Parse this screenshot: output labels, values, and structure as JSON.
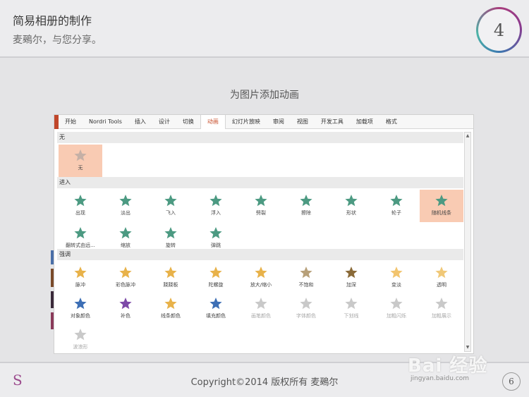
{
  "header": {
    "title": "简易相册的制作",
    "subtitle": "麦鵐尔，与您分享。",
    "chapter_number": "4"
  },
  "caption": "为图片添加动画",
  "ribbon": {
    "tabs": [
      "开始",
      "Nordri Tools",
      "插入",
      "设计",
      "切换",
      "动画",
      "幻灯片放映",
      "审阅",
      "视图",
      "开发工具",
      "加载项",
      "格式"
    ],
    "active_tab": "动画"
  },
  "gallery": {
    "sections": [
      {
        "name": "无"
      },
      {
        "name": "进入"
      },
      {
        "name": "强调"
      }
    ],
    "none_effects": [
      {
        "label": "无",
        "icon": "star-gray",
        "selected": true
      }
    ],
    "entrance_effects": [
      {
        "label": "出现",
        "icon": "star-burst"
      },
      {
        "label": "淡出",
        "icon": "star-soft"
      },
      {
        "label": "飞入",
        "icon": "star-fly"
      },
      {
        "label": "浮入",
        "icon": "star-float"
      },
      {
        "label": "劈裂",
        "icon": "star-split"
      },
      {
        "label": "擦除",
        "icon": "star-wipe"
      },
      {
        "label": "形状",
        "icon": "star-shape"
      },
      {
        "label": "轮子",
        "icon": "star-wheel"
      },
      {
        "label": "随机线条",
        "icon": "star-lines",
        "selected": true
      },
      {
        "label": "翻转式由远...",
        "icon": "star-flip"
      },
      {
        "label": "缩放",
        "icon": "star-zoom"
      },
      {
        "label": "旋转",
        "icon": "star-spin"
      },
      {
        "label": "弹跳",
        "icon": "star-bounce"
      }
    ],
    "emphasis_effects": [
      {
        "label": "脉冲",
        "icon": "star-pulse",
        "color": "#e8b24a"
      },
      {
        "label": "彩色脉冲",
        "icon": "star-color-pulse",
        "color": "#e8b24a"
      },
      {
        "label": "跷跷板",
        "icon": "star-teeter",
        "color": "#e8b24a"
      },
      {
        "label": "陀螺旋",
        "icon": "star-spin-em",
        "color": "#e8b24a"
      },
      {
        "label": "放大/缩小",
        "icon": "star-grow",
        "color": "#e8b24a"
      },
      {
        "label": "不饱和",
        "icon": "star-desaturate",
        "color": "#b7a079"
      },
      {
        "label": "加深",
        "icon": "star-darken",
        "color": "#8a6a38"
      },
      {
        "label": "变淡",
        "icon": "star-lighten",
        "color": "#f2c46e"
      },
      {
        "label": "透明",
        "icon": "star-transparent",
        "color": "#f0c878"
      },
      {
        "label": "对象颜色",
        "icon": "star-object-color",
        "color": "#3d6fb5"
      },
      {
        "label": "补色",
        "icon": "star-complement",
        "color": "#7d4aa8"
      },
      {
        "label": "线条颜色",
        "icon": "star-line-color",
        "color": "#e8b24a"
      },
      {
        "label": "填充颜色",
        "icon": "star-fill-color",
        "color": "#3d6fb5"
      },
      {
        "label": "画笔颜色",
        "icon": "star-brush-color",
        "color": "#c9c9c9",
        "disabled": true
      },
      {
        "label": "字体颜色",
        "icon": "star-font-color",
        "color": "#c9c9c9",
        "disabled": true
      },
      {
        "label": "下划线",
        "icon": "star-underline",
        "color": "#c9c9c9",
        "disabled": true
      },
      {
        "label": "加粗闪烁",
        "icon": "star-bold-flash",
        "color": "#c9c9c9",
        "disabled": true
      },
      {
        "label": "加粗展示",
        "icon": "star-bold-reveal",
        "color": "#c9c9c9",
        "disabled": true
      },
      {
        "label": "波浪形",
        "icon": "star-wave",
        "color": "#c9c9c9",
        "disabled": true
      }
    ]
  },
  "footer": {
    "logo": "S",
    "copyright": "Copyright©2014  版权所有 麦鵐尔",
    "page_number": "6",
    "watermark_text": "Bai 经验",
    "watermark_url": "jingyan.baidu.com"
  },
  "colors": {
    "entrance_green": "#4c9a82",
    "selection": "#f9cbb3",
    "active_tab": "#c8502d"
  }
}
